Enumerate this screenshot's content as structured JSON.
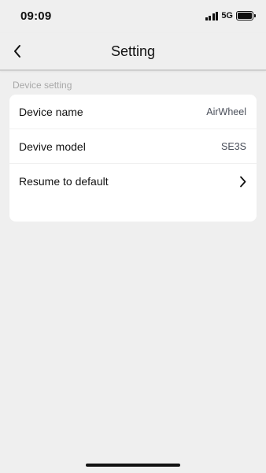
{
  "status_bar": {
    "time": "09:09",
    "network": "5G",
    "icons": [
      "signal-icon",
      "battery-icon"
    ],
    "battery_level": 1.0
  },
  "nav": {
    "back_icon": "chevron-left-icon",
    "title": "Setting"
  },
  "section": {
    "label": "Device setting"
  },
  "rows": [
    {
      "label": "Device name",
      "value": "AirWheel"
    },
    {
      "label": "Devive model",
      "value": "SE3S"
    },
    {
      "label": "Resume to default",
      "icon": "chevron-right-icon"
    }
  ],
  "colors": {
    "background": "#efefef",
    "card": "#ffffff",
    "text": "#111111",
    "muted": "#a8a8a8",
    "value": "#4a4f5a"
  }
}
